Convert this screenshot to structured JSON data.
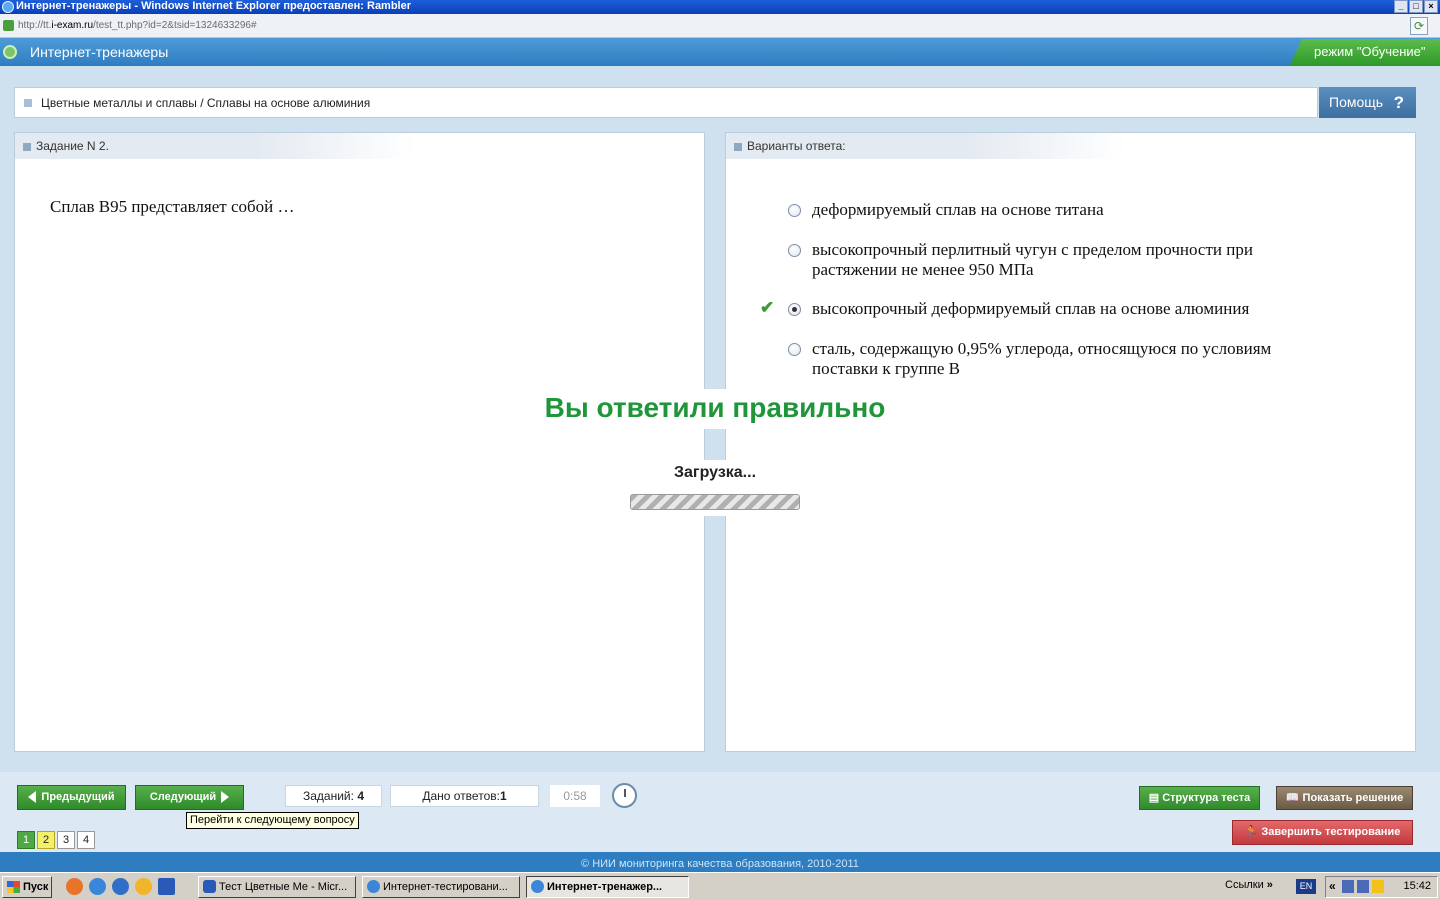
{
  "browser": {
    "title": "Интернет-тренажеры - Windows Internet Explorer предоставлен: Rambler",
    "url_prefix": "http://tt.",
    "url_host": "i-exam.ru",
    "url_path": "/test_tt.php?id=2&tsid=1324633296#"
  },
  "header": {
    "app_title": "Интернет-тренажеры",
    "mode": "режим \"Обучение\""
  },
  "breadcrumb": "Цветные металлы и сплавы / Сплавы на основе алюминия",
  "help_label": "Помощь",
  "question": {
    "heading": "Задание N 2.",
    "text": "Сплав В95 представляет собой …"
  },
  "answers": {
    "heading": "Варианты ответа:",
    "options": [
      {
        "text": "деформируемый сплав на основе титана",
        "selected": false,
        "correct": false
      },
      {
        "text": "высокопрочный перлитный чугун с пределом прочности при растяжении не менее 950 МПа",
        "selected": false,
        "correct": false
      },
      {
        "text": "высокопрочный деформируемый сплав на основе алюминия",
        "selected": true,
        "correct": true
      },
      {
        "text": "сталь, содержащую 0,95% углерода, относящуюся по условиям поставки к группе В",
        "selected": false,
        "correct": false
      }
    ]
  },
  "result_message": "Вы ответили правильно",
  "loading_label": "Загрузка...",
  "toolbar": {
    "prev_label": "Предыдущий",
    "next_label": "Следующий",
    "tasks_label": "Заданий:",
    "tasks_count": "4",
    "answers_label": "Дано ответов:",
    "answers_count": "1",
    "timer": "0:58",
    "tooltip": "Перейти к следующему вопросу",
    "structure_label": "Структура теста",
    "solution_label": "Показать решение",
    "finish_label": "Завершить тестирование",
    "pages": [
      "1",
      "2",
      "3",
      "4"
    ]
  },
  "footer": "© НИИ мониторинга качества образования, 2010-2011",
  "taskbar": {
    "start_label": "Пуск",
    "tasks": [
      "Тест Цветные Ме - Micr...",
      "Интернет-тестировани...",
      "Интернет-тренажер..."
    ],
    "links_label": "Ссылки",
    "lang": "EN",
    "time": "15:42"
  },
  "colors": {
    "header_blue": "#2f7dc1",
    "accent_green": "#2f9a2a",
    "success_text": "#20963a",
    "finish_red": "#c23a3e"
  }
}
